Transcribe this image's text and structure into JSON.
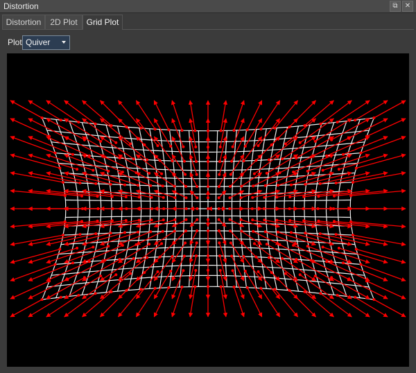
{
  "window": {
    "title": "Distortion"
  },
  "tabs": [
    {
      "label": "Distortion"
    },
    {
      "label": "2D Plot"
    },
    {
      "label": "Grid Plot",
      "active": true
    }
  ],
  "plot": {
    "label": "Plot",
    "selected": "Quiver"
  },
  "colors": {
    "arrow": "#ff0000",
    "grid": "#f0f0f0",
    "background": "#000000"
  }
}
